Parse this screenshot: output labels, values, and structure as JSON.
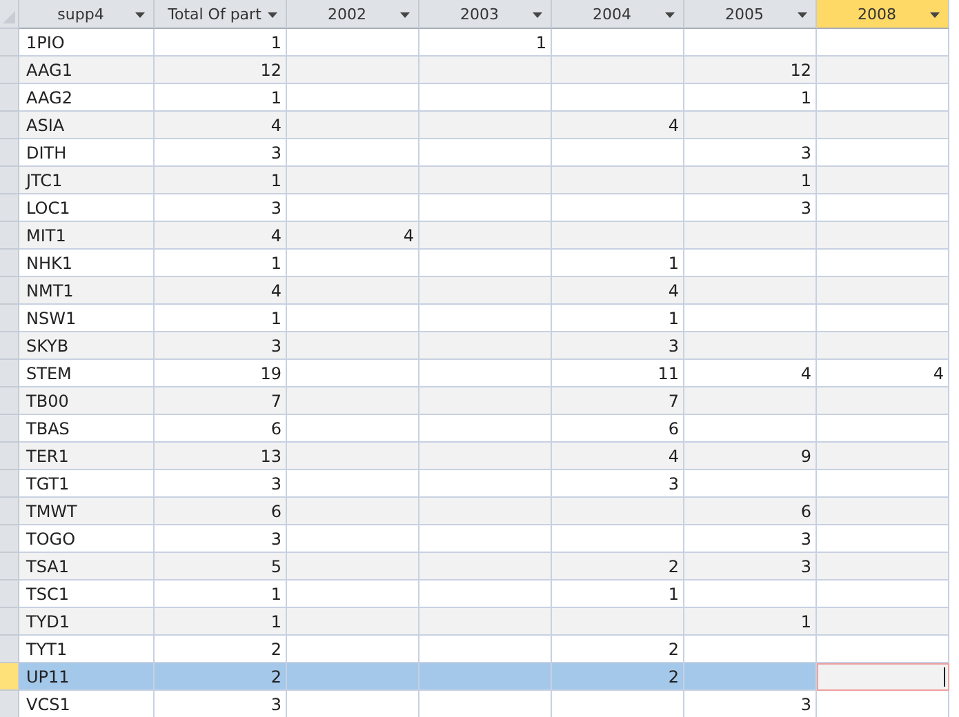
{
  "columns": [
    {
      "label": "supp4",
      "selected": false
    },
    {
      "label": "Total Of part",
      "selected": false
    },
    {
      "label": "2002",
      "selected": false
    },
    {
      "label": "2003",
      "selected": false
    },
    {
      "label": "2004",
      "selected": false
    },
    {
      "label": "2005",
      "selected": false
    },
    {
      "label": "2008",
      "selected": true
    }
  ],
  "rows": [
    {
      "cells": [
        "1PIO",
        "1",
        null,
        "1",
        null,
        null,
        null
      ],
      "selected": false
    },
    {
      "cells": [
        "AAG1",
        "12",
        null,
        null,
        null,
        "12",
        null
      ],
      "selected": false
    },
    {
      "cells": [
        "AAG2",
        "1",
        null,
        null,
        null,
        "1",
        null
      ],
      "selected": false
    },
    {
      "cells": [
        "ASIA",
        "4",
        null,
        null,
        "4",
        null,
        null
      ],
      "selected": false
    },
    {
      "cells": [
        "DITH",
        "3",
        null,
        null,
        null,
        "3",
        null
      ],
      "selected": false
    },
    {
      "cells": [
        "JTC1",
        "1",
        null,
        null,
        null,
        "1",
        null
      ],
      "selected": false
    },
    {
      "cells": [
        "LOC1",
        "3",
        null,
        null,
        null,
        "3",
        null
      ],
      "selected": false
    },
    {
      "cells": [
        "MIT1",
        "4",
        "4",
        null,
        null,
        null,
        null
      ],
      "selected": false
    },
    {
      "cells": [
        "NHK1",
        "1",
        null,
        null,
        "1",
        null,
        null
      ],
      "selected": false
    },
    {
      "cells": [
        "NMT1",
        "4",
        null,
        null,
        "4",
        null,
        null
      ],
      "selected": false
    },
    {
      "cells": [
        "NSW1",
        "1",
        null,
        null,
        "1",
        null,
        null
      ],
      "selected": false
    },
    {
      "cells": [
        "SKYB",
        "3",
        null,
        null,
        "3",
        null,
        null
      ],
      "selected": false
    },
    {
      "cells": [
        "STEM",
        "19",
        null,
        null,
        "11",
        "4",
        "4"
      ],
      "selected": false
    },
    {
      "cells": [
        "TB00",
        "7",
        null,
        null,
        "7",
        null,
        null
      ],
      "selected": false
    },
    {
      "cells": [
        "TBAS",
        "6",
        null,
        null,
        "6",
        null,
        null
      ],
      "selected": false
    },
    {
      "cells": [
        "TER1",
        "13",
        null,
        null,
        "4",
        "9",
        null
      ],
      "selected": false
    },
    {
      "cells": [
        "TGT1",
        "3",
        null,
        null,
        "3",
        null,
        null
      ],
      "selected": false
    },
    {
      "cells": [
        "TMWT",
        "6",
        null,
        null,
        null,
        "6",
        null
      ],
      "selected": false
    },
    {
      "cells": [
        "TOGO",
        "3",
        null,
        null,
        null,
        "3",
        null
      ],
      "selected": false
    },
    {
      "cells": [
        "TSA1",
        "5",
        null,
        null,
        "2",
        "3",
        null
      ],
      "selected": false
    },
    {
      "cells": [
        "TSC1",
        "1",
        null,
        null,
        "1",
        null,
        null
      ],
      "selected": false
    },
    {
      "cells": [
        "TYD1",
        "1",
        null,
        null,
        null,
        "1",
        null
      ],
      "selected": false
    },
    {
      "cells": [
        "TYT1",
        "2",
        null,
        null,
        "2",
        null,
        null
      ],
      "selected": false
    },
    {
      "cells": [
        "UP11",
        "2",
        null,
        null,
        "2",
        null,
        null
      ],
      "selected": true
    },
    {
      "cells": [
        "VCS1",
        "3",
        null,
        null,
        null,
        "3",
        null
      ],
      "selected": false
    }
  ]
}
